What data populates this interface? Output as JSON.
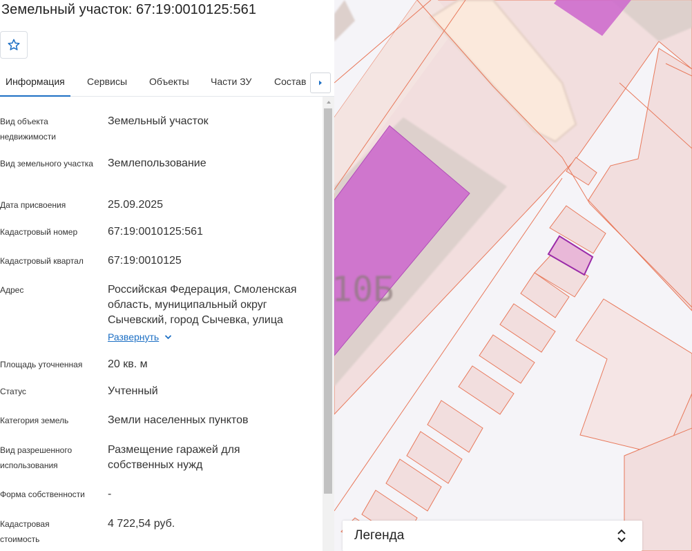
{
  "header": {
    "title": "Земельный участок: 67:19:0010125:561"
  },
  "tabs": [
    {
      "label": "Информация"
    },
    {
      "label": "Сервисы"
    },
    {
      "label": "Объекты"
    },
    {
      "label": "Части ЗУ"
    },
    {
      "label": "Состав"
    }
  ],
  "info": {
    "object_type": {
      "label": "Вид объекта недвижимости",
      "value": "Земельный участок"
    },
    "land_type": {
      "label": "Вид земельного участка",
      "value": "Землепользование"
    },
    "assign_date": {
      "label": "Дата присвоения",
      "value": "25.09.2025"
    },
    "cad_number": {
      "label": "Кадастровый номер",
      "value": "67:19:0010125:561"
    },
    "cad_quarter": {
      "label": "Кадастровый квартал",
      "value": "67:19:0010125"
    },
    "address": {
      "label": "Адрес",
      "value": "Российская Федерация, Смоленская область, муниципальный округ Сычевский, город Сычевка, улица",
      "expand": "Развернуть"
    },
    "area": {
      "label": "Площадь уточненная",
      "value": "20 кв. м"
    },
    "status": {
      "label": "Статус",
      "value": "Учтенный"
    },
    "category": {
      "label": "Категория земель",
      "value": "Земли населенных пунктов"
    },
    "permitted_use": {
      "label": "Вид разрешенного использования",
      "value": "Размещение гаражей для собственных нужд"
    },
    "ownership": {
      "label": "Форма собственности",
      "value": "-"
    },
    "cad_value": {
      "label": "Кадастровая стоимость",
      "value": "4 722,54 руб."
    }
  },
  "map": {
    "building_label": "10Б"
  },
  "legend": {
    "label": "Легенда"
  },
  "colors": {
    "accent": "#1c6fc4",
    "parcel_line": "#e8785a",
    "building": "#cc66cc",
    "selected": "#9a2aa8"
  },
  "icons": {
    "favorite": "star-outline-icon",
    "tabs_next": "caret-right-icon",
    "expand": "chevron-down-icon",
    "legend_toggle": "chevron-up-down-icon"
  }
}
